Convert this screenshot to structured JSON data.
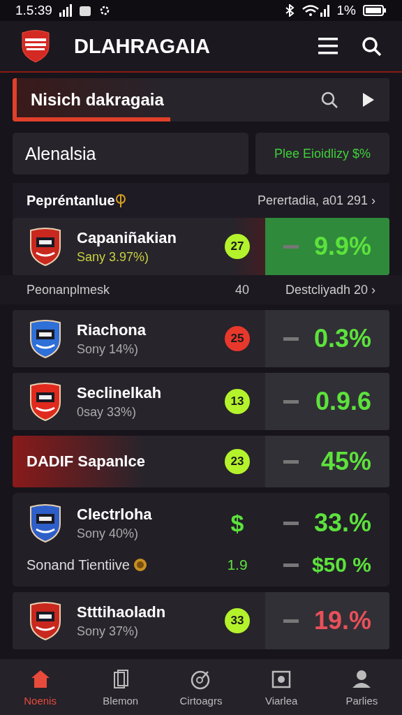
{
  "status_bar": {
    "time": "1.5:39",
    "battery": "1%"
  },
  "app_bar": {
    "title": "DLAHRAGAIA"
  },
  "search": {
    "value": "Nisich dakragaia"
  },
  "filter": {
    "label": "Alenalsia",
    "button": "Plee Eioidlizy $%"
  },
  "section": {
    "title": "Pepréntanlue",
    "link": "Perertadia, a01 291 ›"
  },
  "rows": [
    {
      "kind": "team",
      "name": "Capaniñakian",
      "sub": "Sany 3.97%)",
      "badge": {
        "text": "27",
        "color": "#b4f32c"
      },
      "change": "9.9%",
      "negative": false,
      "highlighted": true,
      "crest": {
        "color": "#c8281e"
      }
    },
    {
      "kind": "subheader",
      "label": "Peonanplmesk",
      "count": "40",
      "link": "Destcliyadh 20 ›"
    },
    {
      "kind": "team",
      "name": "Riachona",
      "sub": "Sony 14%)",
      "badge": {
        "text": "25",
        "color": "#e8382c"
      },
      "change": "0.3%",
      "negative": false,
      "highlighted": false,
      "crest": {
        "color": "#2e6fd8"
      }
    },
    {
      "kind": "team",
      "name": "Seclinelkah",
      "sub": "0say 33%)",
      "badge": {
        "text": "13",
        "color": "#b4f32c"
      },
      "change": "0.9.6",
      "negative": false,
      "highlighted": false,
      "crest": {
        "color": "#e02a1e"
      }
    },
    {
      "kind": "banner",
      "name": "DADIF Sapanlce",
      "badge": {
        "text": "23",
        "color": "#b4f32c"
      },
      "change": "45%",
      "negative": false
    },
    {
      "kind": "card",
      "name": "Clectrloha",
      "sub": "Sony 40%)",
      "symbol": "$",
      "change": "33.%",
      "negative": false,
      "crest": {
        "color": "#2e5fc8"
      },
      "line2": {
        "label": "Sonand Tientiive",
        "value": "1.9",
        "change": "$50 %"
      }
    },
    {
      "kind": "team",
      "name": "Stttihaoladn",
      "sub": "Sony 37%)",
      "badge": {
        "text": "33",
        "color": "#b4f32c"
      },
      "change": "19.%",
      "negative": true,
      "highlighted": false,
      "crest": {
        "color": "#c8281e"
      }
    }
  ],
  "nav": [
    {
      "label": "Noenis",
      "selected": true
    },
    {
      "label": "Blemon",
      "selected": false
    },
    {
      "label": "Cirtoagrs",
      "selected": false
    },
    {
      "label": "Viarlea",
      "selected": false
    },
    {
      "label": "Parlies",
      "selected": false
    }
  ]
}
